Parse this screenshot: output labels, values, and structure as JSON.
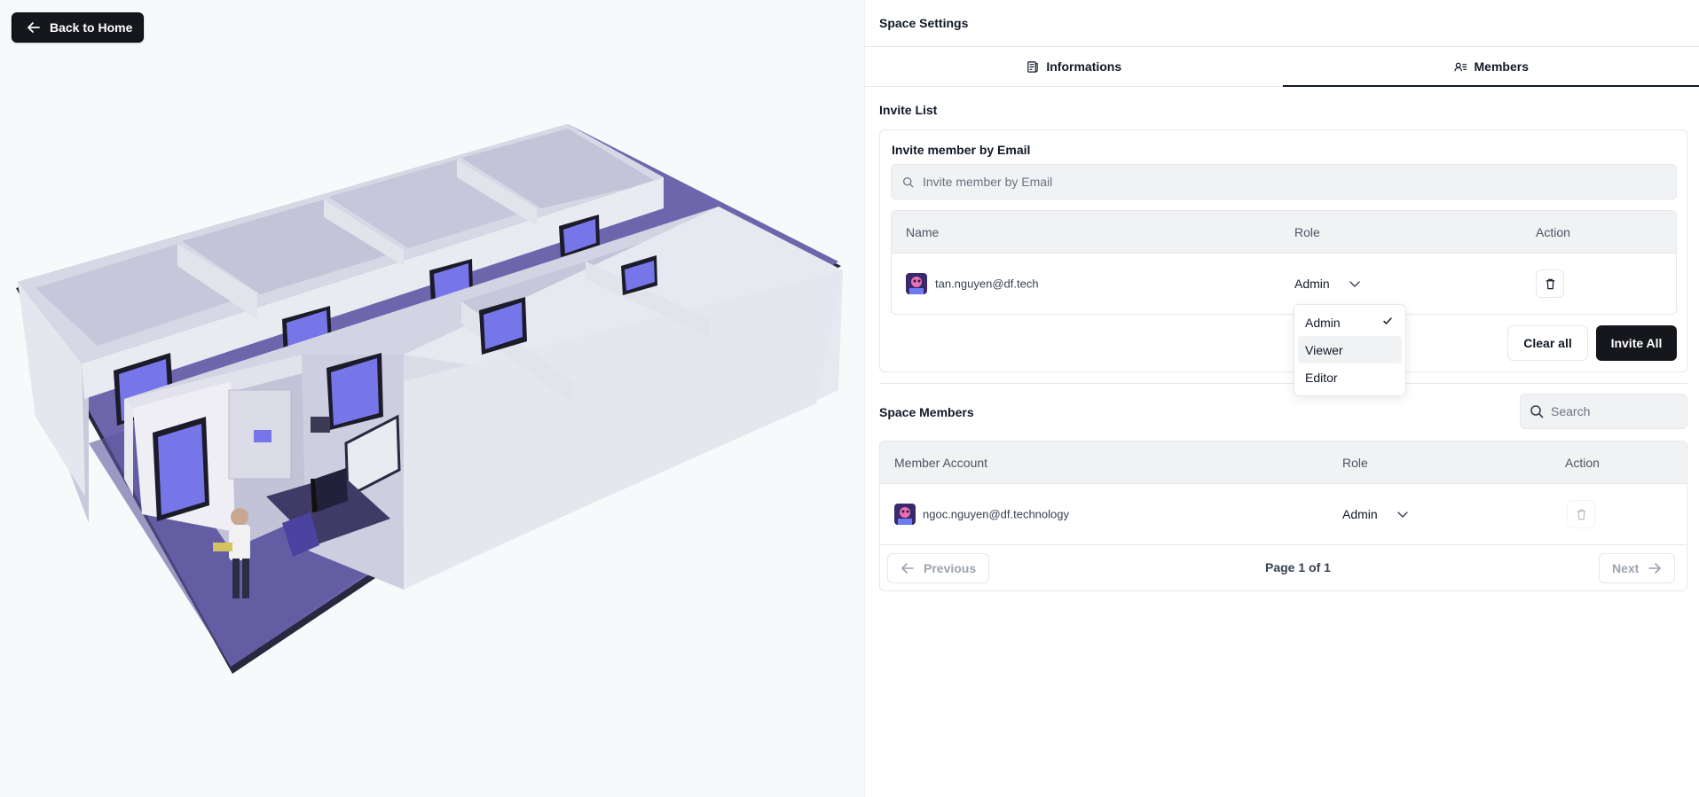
{
  "viewport": {
    "back_button_label": "Back to Home"
  },
  "panel": {
    "title": "Space Settings",
    "tabs": [
      {
        "label": "Informations",
        "icon": "document-icon",
        "active": false
      },
      {
        "label": "Members",
        "icon": "members-icon",
        "active": true
      }
    ],
    "invite_list_label": "Invite List",
    "invite_card": {
      "title": "Invite member by Email",
      "email_placeholder": "Invite member by Email",
      "table_headers": {
        "name": "Name",
        "role": "Role",
        "action": "Action"
      },
      "rows": [
        {
          "email": "tan.nguyen@df.tech",
          "role": "Admin"
        }
      ],
      "clear_label": "Clear all",
      "invite_label": "Invite All"
    },
    "role_dropdown": {
      "options": [
        "Admin",
        "Viewer",
        "Editor"
      ],
      "selected": "Admin",
      "highlighted": "Viewer"
    },
    "space_members": {
      "title": "Space Members",
      "search_placeholder": "Search",
      "table_headers": {
        "account": "Member Account",
        "role": "Role",
        "action": "Action"
      },
      "rows": [
        {
          "email": "ngoc.nguyen@df.technology",
          "role": "Admin"
        }
      ],
      "pager": {
        "previous_label": "Previous",
        "page_info": "Page 1 of 1",
        "next_label": "Next"
      }
    }
  },
  "colors": {
    "dark_button": "#15171c",
    "floor": "#6c64ab",
    "walls": "#d8d9e6",
    "doors": "#7474e6"
  }
}
